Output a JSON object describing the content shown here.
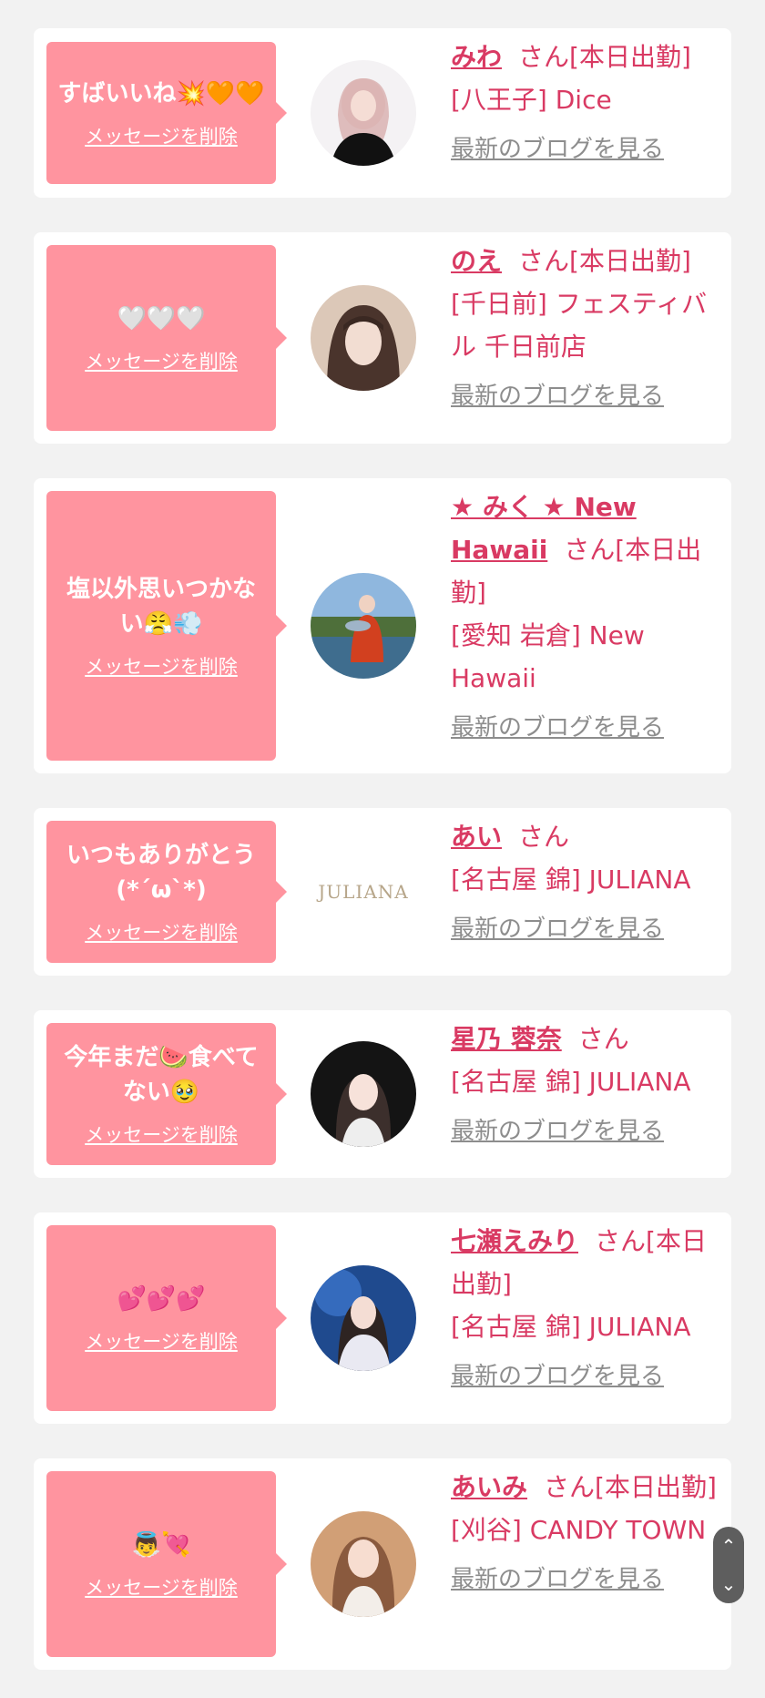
{
  "cards": [
    {
      "message": "すばいいね💥🧡🧡",
      "delete_label": "メッセージを削除",
      "name": "みわ",
      "suffix": "さん[本日出勤]",
      "shop": "[八王子] Dice",
      "blog_label": "最新のブログを見る"
    },
    {
      "message": "🤍🤍🤍",
      "delete_label": "メッセージを削除",
      "name": "のえ",
      "suffix": "さん[本日出勤]",
      "shop": "[千日前] フェスティバル 千日前店",
      "blog_label": "最新のブログを見る"
    },
    {
      "message": "塩以外思いつかない😤💨",
      "delete_label": "メッセージを削除",
      "name": "★ みく ★ New Hawaii",
      "suffix": "さん[本日出勤]",
      "shop": "[愛知 岩倉] New Hawaii",
      "blog_label": "最新のブログを見る"
    },
    {
      "message": "いつもありがとう(*´ω`*)",
      "delete_label": "メッセージを削除",
      "name": "あい",
      "suffix": "さん",
      "shop": "[名古屋 錦] JULIANA",
      "blog_label": "最新のブログを見る",
      "logo_text": "JULIANA"
    },
    {
      "message": "今年まだ🍉食べてない🥹",
      "delete_label": "メッセージを削除",
      "name": "星乃 蓉奈",
      "suffix": "さん",
      "shop": "[名古屋 錦] JULIANA",
      "blog_label": "最新のブログを見る"
    },
    {
      "message": "💕💕💕",
      "delete_label": "メッセージを削除",
      "name": "七瀬えみり",
      "suffix": "さん[本日出勤]",
      "shop": "[名古屋 錦] JULIANA",
      "blog_label": "最新のブログを見る"
    },
    {
      "message": "👼💘",
      "delete_label": "メッセージを削除",
      "name": "あいみ",
      "suffix": "さん[本日出勤]",
      "shop": "[刈谷] CANDY TOWN",
      "blog_label": "最新のブログを見る"
    }
  ],
  "scroll": {
    "up_icon": "chevron-up-icon",
    "down_icon": "chevron-down-icon"
  },
  "colors": {
    "bubble": "#ff949f",
    "accent": "#d93a63",
    "link_gray": "#8d8d8d",
    "page_bg": "#f2f2f2"
  }
}
